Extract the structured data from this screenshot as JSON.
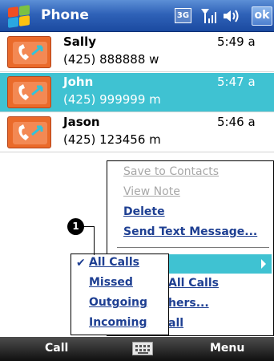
{
  "titlebar": {
    "title": "Phone",
    "network_indicator": "3G",
    "ok_label": "ok",
    "icons": [
      "windows-start-icon",
      "signal-icon",
      "volume-icon"
    ]
  },
  "calls": [
    {
      "name": "Sally",
      "time": "5:49 a",
      "number": "(425) 888888 w",
      "icon": "outgoing-call-icon",
      "selected": false
    },
    {
      "name": "John",
      "time": "5:47 a",
      "number": "(425) 999999 m",
      "icon": "outgoing-call-icon",
      "selected": true
    },
    {
      "name": "Jason",
      "time": "5:46 a",
      "number": "(425) 123456 m",
      "icon": "outgoing-call-icon",
      "selected": false
    }
  ],
  "context_menu": {
    "items": [
      {
        "label": "Save to Contacts",
        "enabled": false
      },
      {
        "label": "View Note",
        "enabled": false
      },
      {
        "label": "Delete",
        "enabled": true
      },
      {
        "label": "Send Text Message...",
        "enabled": true
      }
    ],
    "visible_partial_items": [
      "All Calls",
      "hers...",
      "all"
    ]
  },
  "filter_submenu": {
    "items": [
      {
        "label": "All Calls",
        "checked": true
      },
      {
        "label": "Missed",
        "checked": false
      },
      {
        "label": "Outgoing",
        "checked": false
      },
      {
        "label": "Incoming",
        "checked": false
      }
    ]
  },
  "callout": {
    "marker": "1"
  },
  "bottombar": {
    "left_softkey": "Call",
    "right_softkey": "Menu",
    "center_icon": "keyboard-icon"
  },
  "colors": {
    "titlebar": "#2f62b8",
    "selection": "#3fc2d2",
    "call_icon": "#ea6a2a",
    "menu_text": "#1e3f92",
    "disabled_text": "#a8a8a8",
    "bottombar": "#101010"
  }
}
